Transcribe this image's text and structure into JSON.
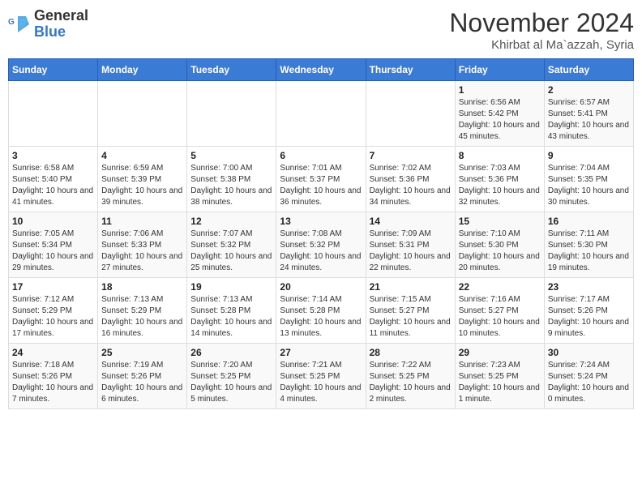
{
  "logo": {
    "general": "General",
    "blue": "Blue"
  },
  "header": {
    "month": "November 2024",
    "location": "Khirbat al Ma`azzah, Syria"
  },
  "weekdays": [
    "Sunday",
    "Monday",
    "Tuesday",
    "Wednesday",
    "Thursday",
    "Friday",
    "Saturday"
  ],
  "weeks": [
    [
      {
        "day": "",
        "info": ""
      },
      {
        "day": "",
        "info": ""
      },
      {
        "day": "",
        "info": ""
      },
      {
        "day": "",
        "info": ""
      },
      {
        "day": "",
        "info": ""
      },
      {
        "day": "1",
        "info": "Sunrise: 6:56 AM\nSunset: 5:42 PM\nDaylight: 10 hours and 45 minutes."
      },
      {
        "day": "2",
        "info": "Sunrise: 6:57 AM\nSunset: 5:41 PM\nDaylight: 10 hours and 43 minutes."
      }
    ],
    [
      {
        "day": "3",
        "info": "Sunrise: 6:58 AM\nSunset: 5:40 PM\nDaylight: 10 hours and 41 minutes."
      },
      {
        "day": "4",
        "info": "Sunrise: 6:59 AM\nSunset: 5:39 PM\nDaylight: 10 hours and 39 minutes."
      },
      {
        "day": "5",
        "info": "Sunrise: 7:00 AM\nSunset: 5:38 PM\nDaylight: 10 hours and 38 minutes."
      },
      {
        "day": "6",
        "info": "Sunrise: 7:01 AM\nSunset: 5:37 PM\nDaylight: 10 hours and 36 minutes."
      },
      {
        "day": "7",
        "info": "Sunrise: 7:02 AM\nSunset: 5:36 PM\nDaylight: 10 hours and 34 minutes."
      },
      {
        "day": "8",
        "info": "Sunrise: 7:03 AM\nSunset: 5:36 PM\nDaylight: 10 hours and 32 minutes."
      },
      {
        "day": "9",
        "info": "Sunrise: 7:04 AM\nSunset: 5:35 PM\nDaylight: 10 hours and 30 minutes."
      }
    ],
    [
      {
        "day": "10",
        "info": "Sunrise: 7:05 AM\nSunset: 5:34 PM\nDaylight: 10 hours and 29 minutes."
      },
      {
        "day": "11",
        "info": "Sunrise: 7:06 AM\nSunset: 5:33 PM\nDaylight: 10 hours and 27 minutes."
      },
      {
        "day": "12",
        "info": "Sunrise: 7:07 AM\nSunset: 5:32 PM\nDaylight: 10 hours and 25 minutes."
      },
      {
        "day": "13",
        "info": "Sunrise: 7:08 AM\nSunset: 5:32 PM\nDaylight: 10 hours and 24 minutes."
      },
      {
        "day": "14",
        "info": "Sunrise: 7:09 AM\nSunset: 5:31 PM\nDaylight: 10 hours and 22 minutes."
      },
      {
        "day": "15",
        "info": "Sunrise: 7:10 AM\nSunset: 5:30 PM\nDaylight: 10 hours and 20 minutes."
      },
      {
        "day": "16",
        "info": "Sunrise: 7:11 AM\nSunset: 5:30 PM\nDaylight: 10 hours and 19 minutes."
      }
    ],
    [
      {
        "day": "17",
        "info": "Sunrise: 7:12 AM\nSunset: 5:29 PM\nDaylight: 10 hours and 17 minutes."
      },
      {
        "day": "18",
        "info": "Sunrise: 7:13 AM\nSunset: 5:29 PM\nDaylight: 10 hours and 16 minutes."
      },
      {
        "day": "19",
        "info": "Sunrise: 7:13 AM\nSunset: 5:28 PM\nDaylight: 10 hours and 14 minutes."
      },
      {
        "day": "20",
        "info": "Sunrise: 7:14 AM\nSunset: 5:28 PM\nDaylight: 10 hours and 13 minutes."
      },
      {
        "day": "21",
        "info": "Sunrise: 7:15 AM\nSunset: 5:27 PM\nDaylight: 10 hours and 11 minutes."
      },
      {
        "day": "22",
        "info": "Sunrise: 7:16 AM\nSunset: 5:27 PM\nDaylight: 10 hours and 10 minutes."
      },
      {
        "day": "23",
        "info": "Sunrise: 7:17 AM\nSunset: 5:26 PM\nDaylight: 10 hours and 9 minutes."
      }
    ],
    [
      {
        "day": "24",
        "info": "Sunrise: 7:18 AM\nSunset: 5:26 PM\nDaylight: 10 hours and 7 minutes."
      },
      {
        "day": "25",
        "info": "Sunrise: 7:19 AM\nSunset: 5:26 PM\nDaylight: 10 hours and 6 minutes."
      },
      {
        "day": "26",
        "info": "Sunrise: 7:20 AM\nSunset: 5:25 PM\nDaylight: 10 hours and 5 minutes."
      },
      {
        "day": "27",
        "info": "Sunrise: 7:21 AM\nSunset: 5:25 PM\nDaylight: 10 hours and 4 minutes."
      },
      {
        "day": "28",
        "info": "Sunrise: 7:22 AM\nSunset: 5:25 PM\nDaylight: 10 hours and 2 minutes."
      },
      {
        "day": "29",
        "info": "Sunrise: 7:23 AM\nSunset: 5:25 PM\nDaylight: 10 hours and 1 minute."
      },
      {
        "day": "30",
        "info": "Sunrise: 7:24 AM\nSunset: 5:24 PM\nDaylight: 10 hours and 0 minutes."
      }
    ]
  ]
}
